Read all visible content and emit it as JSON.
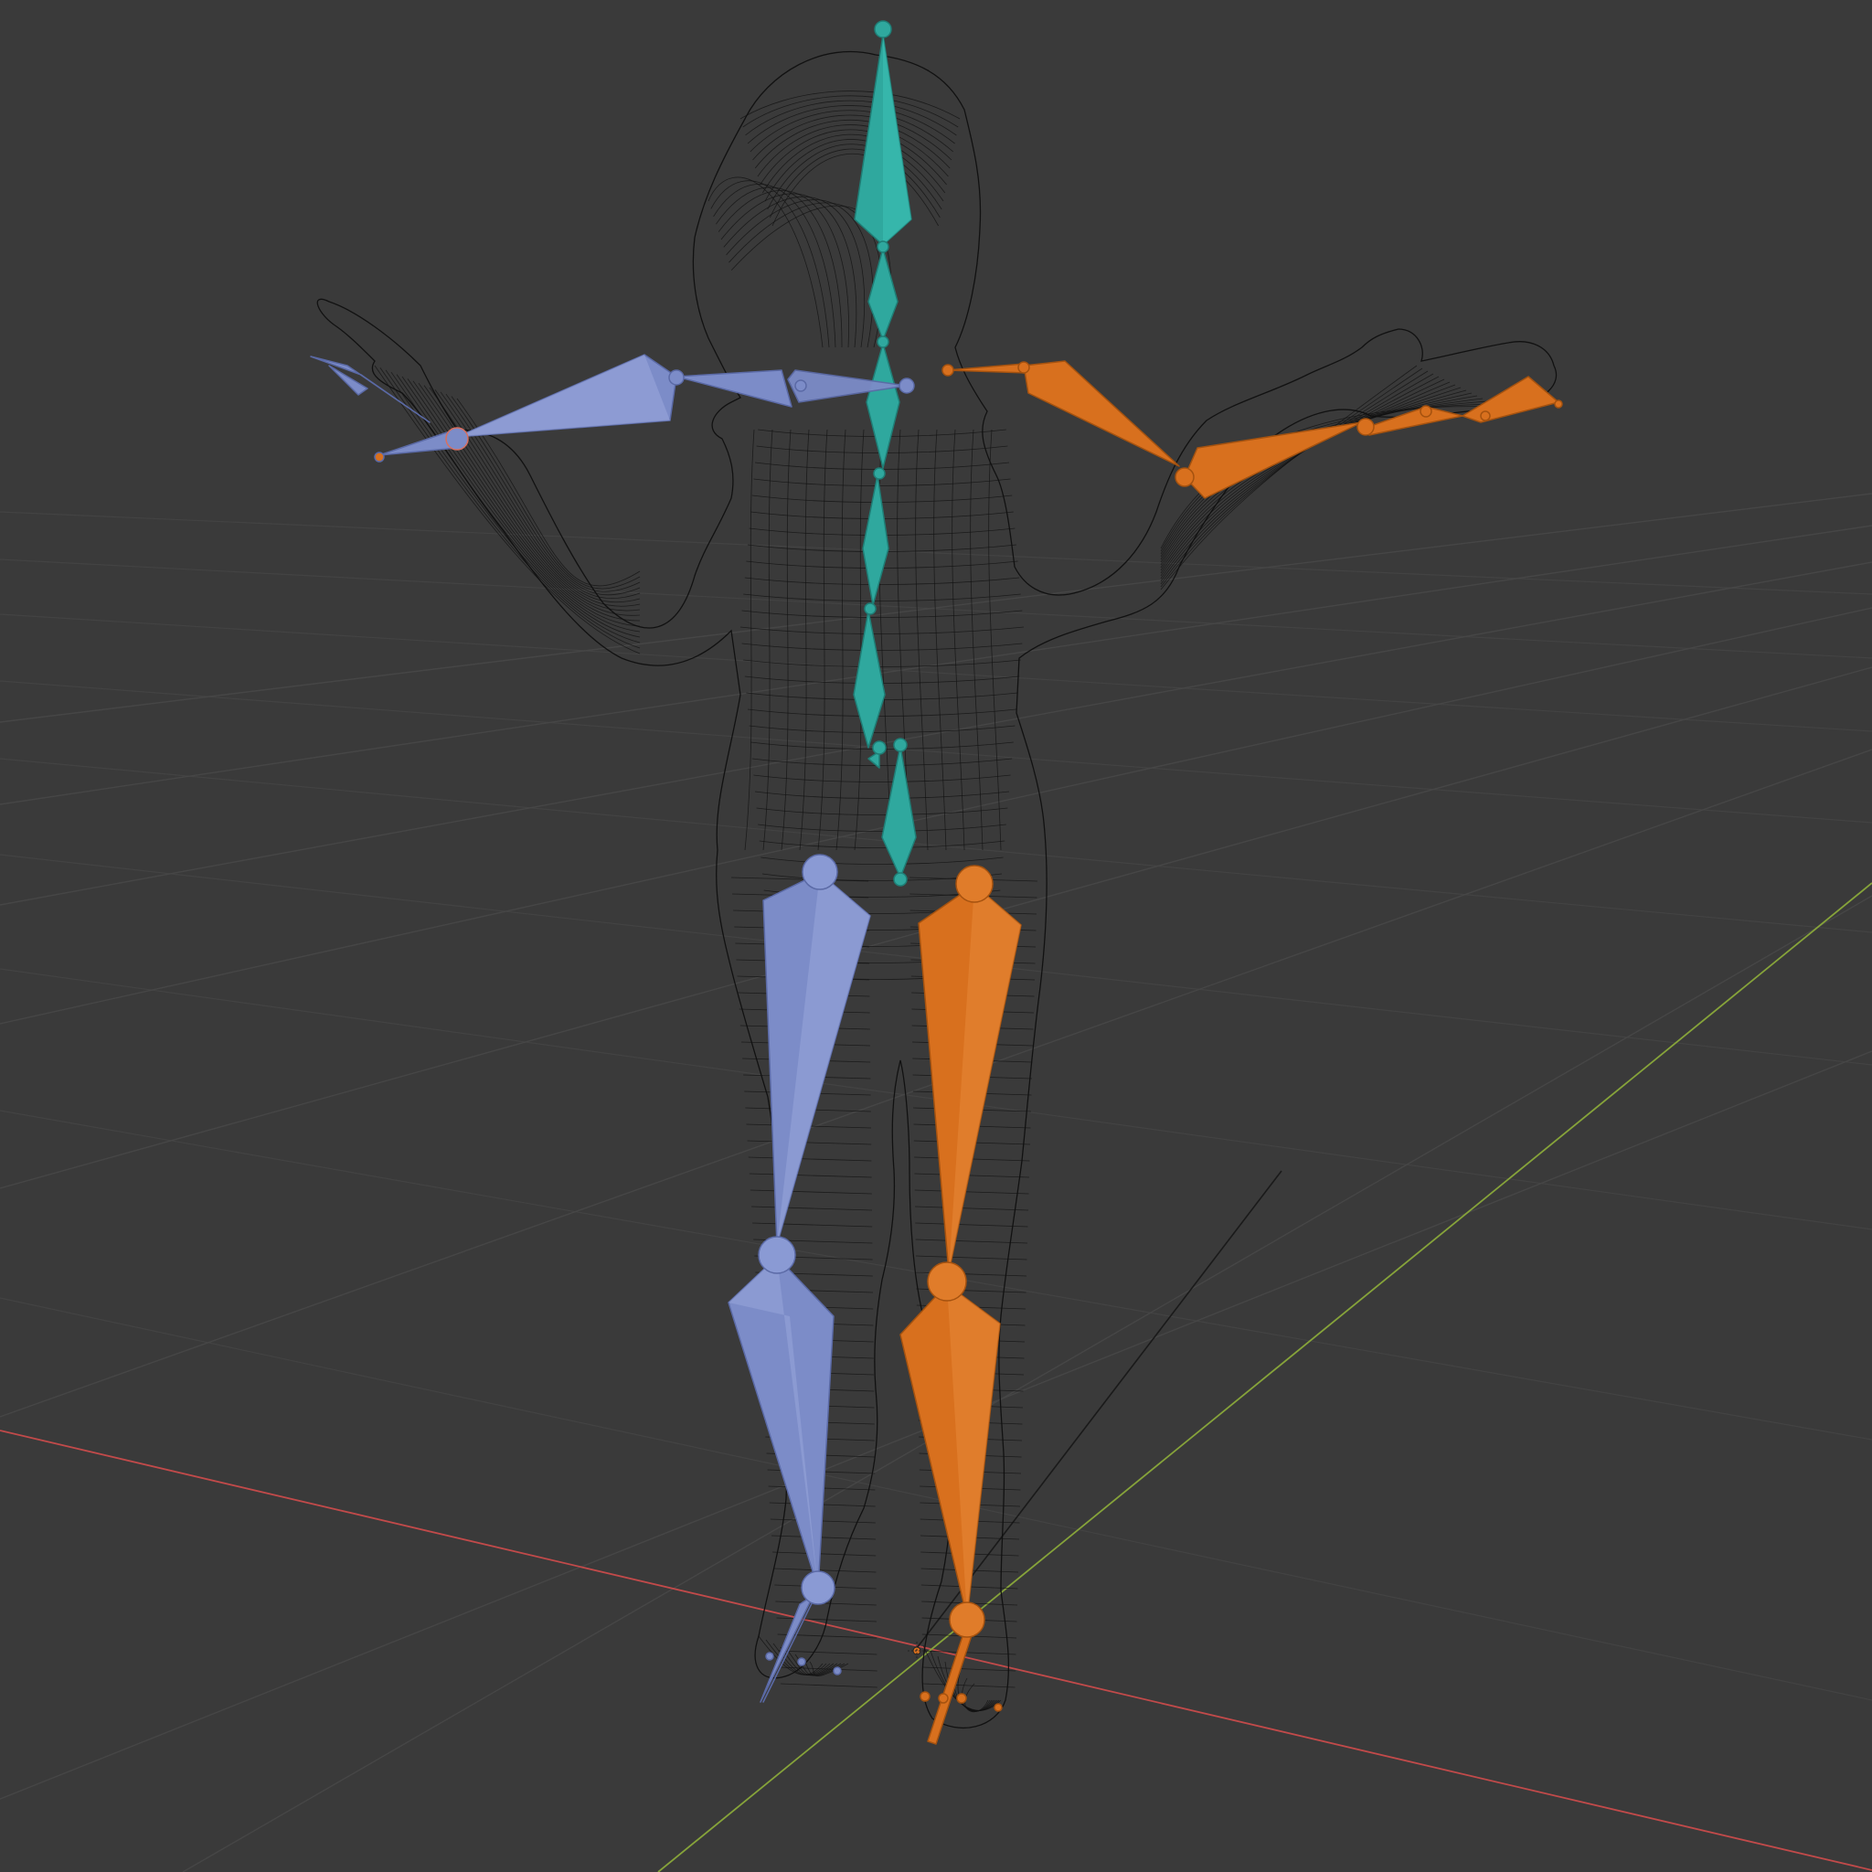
{
  "viewport": {
    "background_color": "#3a3a3a",
    "grid_color": "#464646",
    "x_axis_color": "#c24a4a",
    "y_axis_color": "#86a33a",
    "z_axis_color": "#1a1a1a"
  },
  "armature": {
    "center_bone_color": "#2fa89e",
    "left_bone_color": "#7c8cc8",
    "right_bone_color": "#d8701e",
    "bone_groups": [
      "spine",
      "head",
      "left-arm",
      "right-arm",
      "left-leg",
      "right-leg"
    ]
  },
  "mesh": {
    "display": "wireframe",
    "wire_color": "#0d0d0d",
    "subject": "human figure"
  },
  "icons": {
    "origin": "object-origin-icon"
  }
}
